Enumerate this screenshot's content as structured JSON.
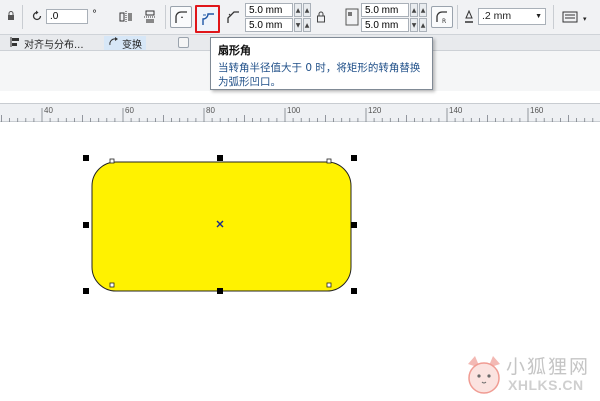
{
  "propbar": {
    "rotate_value": ".0",
    "rotate_unit": "°",
    "corner_radius_tl": "5.0 mm",
    "corner_radius_bl": "5.0 mm",
    "corner_radius_tr": "5.0 mm",
    "corner_radius_br": "5.0 mm",
    "outline_width": ".2 mm"
  },
  "tabs": [
    {
      "label": "对齐与分布..."
    },
    {
      "label": "变换"
    }
  ],
  "tooltip": {
    "title": "扇形角",
    "body": "当转角半径值大于 0 时，将矩形的转角替换为弧形凹口。"
  },
  "ruler": {
    "labels": [
      "40",
      "60",
      "80",
      "100",
      "120",
      "140",
      "160"
    ],
    "unit": "mm"
  },
  "shape": {
    "fill_color": "#fff200",
    "stroke_color": "#222222",
    "type": "rounded-rectangle"
  },
  "watermark": {
    "cn": "小狐狸网",
    "en": "XHLKS.CN"
  }
}
